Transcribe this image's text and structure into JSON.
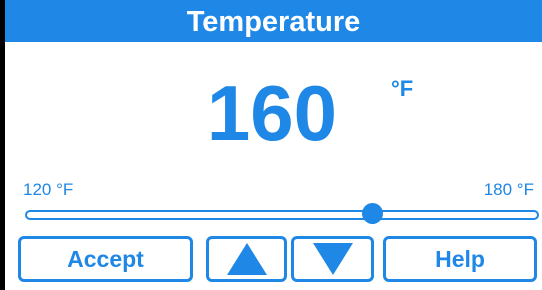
{
  "title": "Temperature",
  "setpoint": {
    "value": "160",
    "unit": "°F"
  },
  "range": {
    "min_label": "120 °F",
    "max_label": "180 °F",
    "min": 120,
    "max": 180
  },
  "slider_value": 160,
  "buttons": {
    "accept": "Accept",
    "up": "arrow-up-icon",
    "down": "arrow-down-icon",
    "help": "Help"
  },
  "colors": {
    "accent": "#1f87e6",
    "background": "#ffffff"
  }
}
